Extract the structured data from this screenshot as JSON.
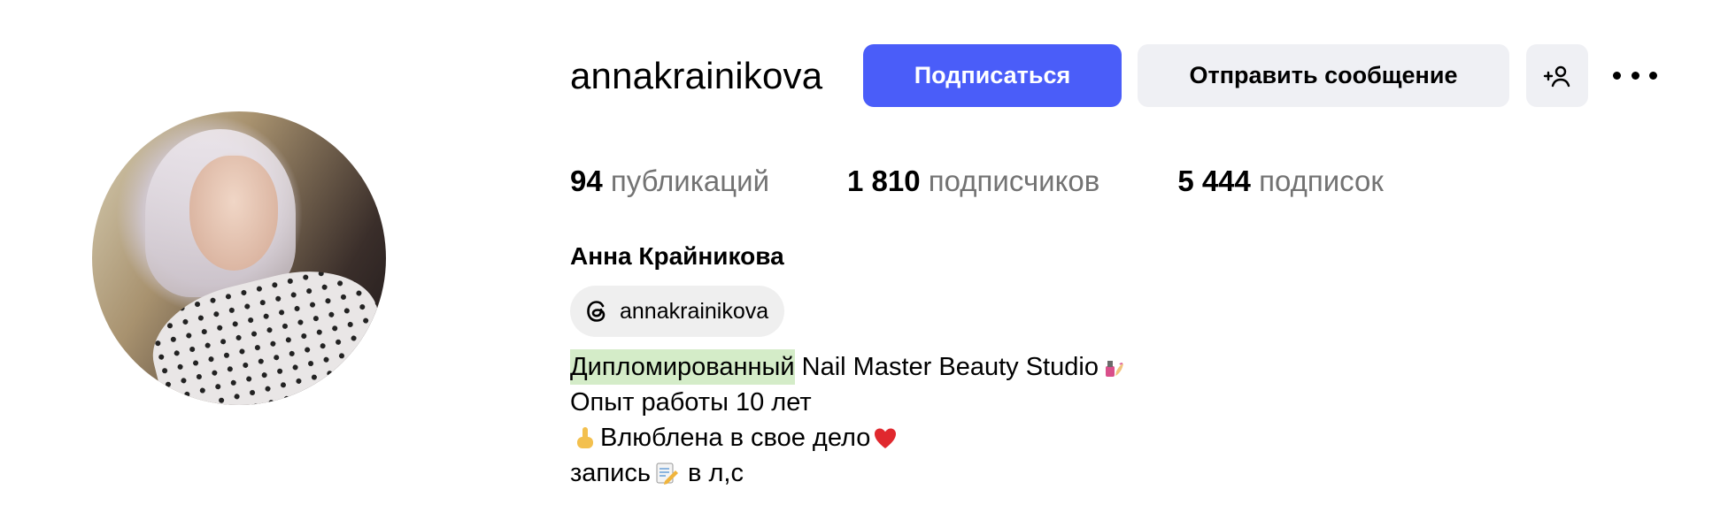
{
  "profile": {
    "username": "annakrainikova",
    "full_name": "Анна Крайникова"
  },
  "actions": {
    "follow_label": "Подписаться",
    "message_label": "Отправить сообщение",
    "add_user_icon": "add-user-icon",
    "more_icon": "more-dots-icon"
  },
  "stats": [
    {
      "value": "94",
      "label": "публикаций"
    },
    {
      "value": "1 810",
      "label": "подписчиков"
    },
    {
      "value": "5 444",
      "label": "подписок"
    }
  ],
  "threads": {
    "icon": "threads-icon",
    "handle": "annakrainikova"
  },
  "bio": {
    "line1_highlight": "Дипломированный",
    "line1_rest": "Nail Master Beauty Studio",
    "line1_emoji": "nail-polish-emoji",
    "line2": "Опыт работы 10 лет",
    "line3_emoji_left": "pointing-up-emoji",
    "line3_text": "Влюблена в свое дело",
    "line3_emoji_right": "red-heart-emoji",
    "line4_text_a": "запись",
    "line4_emoji": "memo-emoji",
    "line4_text_b": "в л,с"
  },
  "colors": {
    "primary_button": "#4a5df9",
    "secondary_button": "#eff0f4",
    "muted_text": "#737373",
    "highlight": "#d4ecc8",
    "heart": "#e0282e"
  }
}
